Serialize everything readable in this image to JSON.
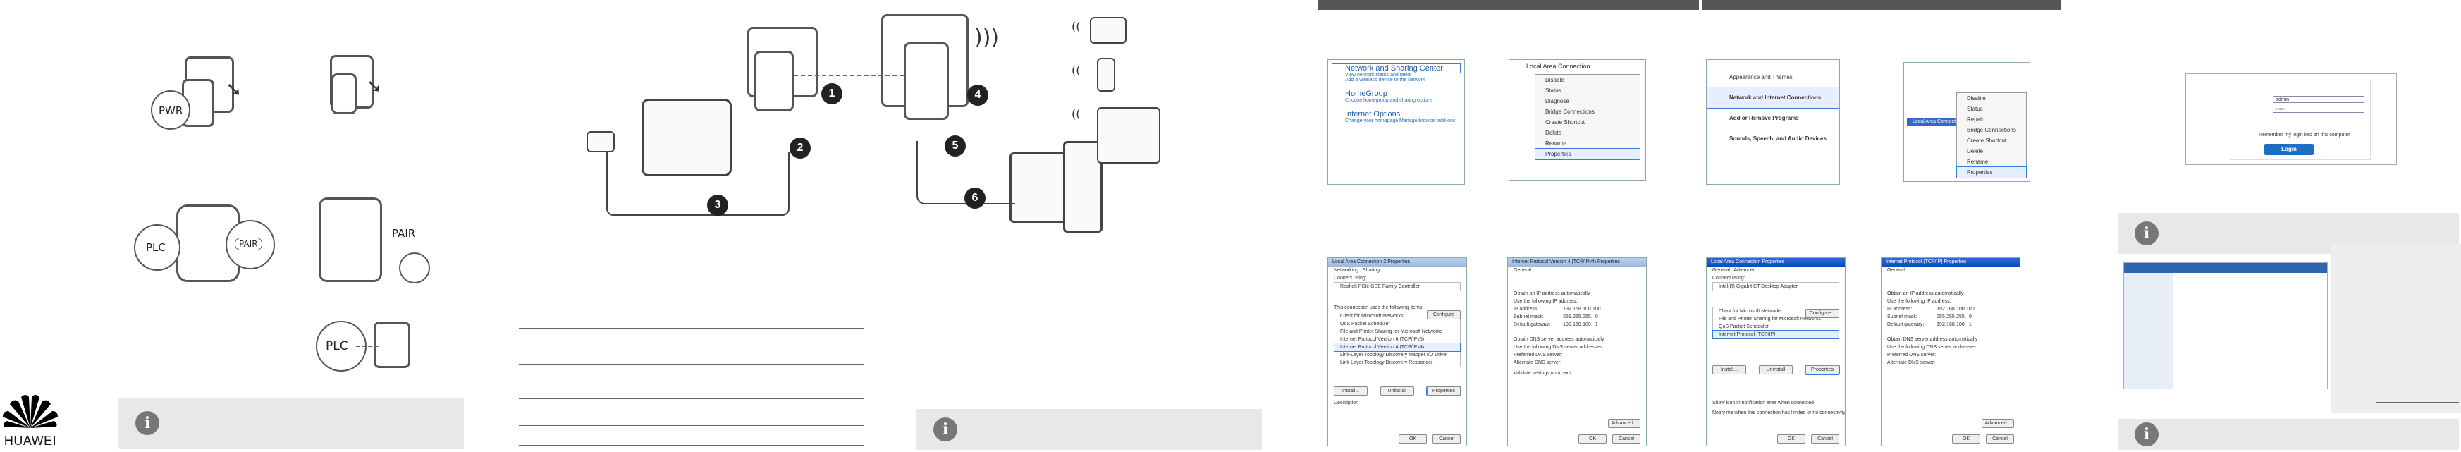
{
  "brand": {
    "name": "HUAWEI"
  },
  "colors": {
    "bar": "#555555",
    "tip_bg": "#e8e8e8",
    "link": "#1b5ea8",
    "login_btn": "#1e6fc4"
  },
  "panel1": {
    "labels": {
      "pwr": "PWR",
      "pair1": "PAIR",
      "pair2": "PAIR",
      "plc1": "PLC",
      "plc2": "PLC"
    },
    "tip_icon": "i"
  },
  "panel2": {
    "badges": [
      "1",
      "2",
      "3",
      "4",
      "5",
      "6"
    ],
    "tip_icon": "i"
  },
  "panel3": {
    "net_center": {
      "title": "Network and Sharing Center",
      "sub1": "View network status and tasks",
      "sub2": "Add a wireless device to the network",
      "home": "HomeGroup",
      "home_sub": "Choose homegroup and sharing options",
      "inet": "Internet Options",
      "inet_sub": "Change your homepage   Manage browser add-ons"
    },
    "lan_menu": {
      "title": "Local Area Connection",
      "items": [
        "Disable",
        "Status",
        "Diagnose",
        "Bridge Connections",
        "Create Shortcut",
        "Delete",
        "Rename",
        "Properties"
      ]
    },
    "lan_props": {
      "title": "Local Area Connection 2 Properties",
      "tabs": [
        "Networking",
        "Sharing"
      ],
      "connect_using": "Connect using:",
      "adapter": "Realtek PCIe GBE Family Controller",
      "configure": "Configure",
      "uses": "This connection uses the following items:",
      "items": [
        "Client for Microsoft Networks",
        "QoS Packet Scheduler",
        "File and Printer Sharing for Microsoft Networks",
        "Internet Protocol Version 6 (TCP/IPv6)",
        "Internet Protocol Version 4 (TCP/IPv4)",
        "Link-Layer Topology Discovery Mapper I/O Driver",
        "Link-Layer Topology Discovery Responder"
      ],
      "install": "Install...",
      "uninstall": "Uninstall",
      "properties": "Properties",
      "desc_title": "Description",
      "ok": "OK",
      "cancel": "Cancel"
    },
    "ipv4": {
      "title": "Internet Protocol Version 4 (TCP/IPv4) Properties",
      "tab": "General",
      "auto": "Obtain an IP address automatically",
      "manual": "Use the following IP address:",
      "ip_label": "IP address:",
      "ip": [
        "192",
        "168",
        "100",
        "100"
      ],
      "mask_label": "Subnet mask:",
      "mask": [
        "255",
        "255",
        "255",
        "0"
      ],
      "gw_label": "Default gateway:",
      "gw": [
        "192",
        "168",
        "100",
        "1"
      ],
      "dns_auto": "Obtain DNS server address automatically",
      "dns_manual": "Use the following DNS server addresses:",
      "pref_dns": "Preferred DNS server:",
      "alt_dns": "Alternate DNS server:",
      "validate": "Validate settings upon exit",
      "advanced": "Advanced...",
      "ok": "OK",
      "cancel": "Cancel"
    }
  },
  "panel4": {
    "control_panel": {
      "items": [
        "Appearance and Themes",
        "Network and Internet Connections",
        "Add or Remove Programs",
        "Sounds, Speech, and Audio Devices"
      ]
    },
    "lan_menu": {
      "caption": "Local Area Connection",
      "items": [
        "Disable",
        "Status",
        "Repair",
        "Bridge Connections",
        "Create Shortcut",
        "Delete",
        "Rename",
        "Properties"
      ]
    },
    "lan_props": {
      "title": "Local Area Connection Properties",
      "tabs": [
        "General",
        "Advanced"
      ],
      "connect_using": "Connect using:",
      "adapter": "Intel(R) Gigabit CT Desktop Adapter",
      "configure": "Configure...",
      "items": [
        "Client for Microsoft Networks",
        "File and Printer Sharing for Microsoft Networks",
        "QoS Packet Scheduler",
        "Internet Protocol (TCP/IP)"
      ],
      "install": "Install...",
      "uninstall": "Uninstall",
      "properties": "Properties",
      "show_icon": "Show icon in notification area when connected",
      "notify": "Notify me when this connection has limited or no connectivity",
      "ok": "OK",
      "cancel": "Cancel"
    },
    "tcpip": {
      "title": "Internet Protocol (TCP/IP) Properties",
      "tab": "General",
      "auto": "Obtain an IP address automatically",
      "manual": "Use the following IP address:",
      "ip_label": "IP address:",
      "ip": [
        "192",
        "168",
        "100",
        "100"
      ],
      "mask_label": "Subnet mask:",
      "mask": [
        "255",
        "255",
        "255",
        "0"
      ],
      "gw_label": "Default gateway:",
      "gw": [
        "192",
        "168",
        "100",
        "1"
      ],
      "dns_auto": "Obtain DNS server address automatically",
      "dns_manual": "Use the following DNS server addresses:",
      "pref_dns": "Preferred DNS server:",
      "alt_dns": "Alternate DNS server:",
      "advanced": "Advanced...",
      "ok": "OK",
      "cancel": "Cancel"
    }
  },
  "panel5": {
    "login": {
      "username": "admin",
      "password": "••••••",
      "remember": "Remember my login info on this computer",
      "button": "Login"
    },
    "tip_icon": "i",
    "tip_icon2": "i"
  }
}
